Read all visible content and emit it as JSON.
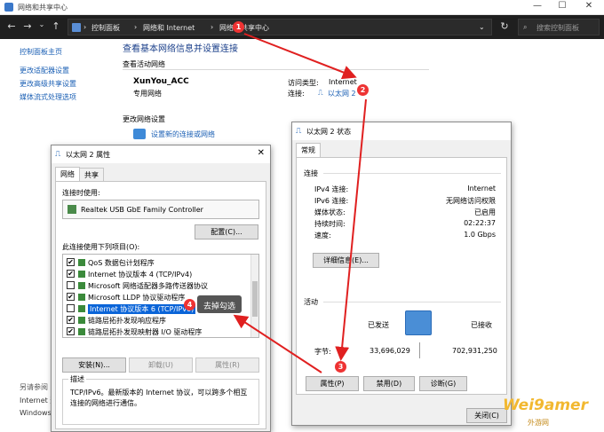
{
  "window": {
    "title": "网络和共享中心",
    "controls": [
      "—",
      "☐",
      "✕"
    ]
  },
  "address": {
    "crumbs": [
      "控制面板",
      "网络和 Internet",
      "网络和共享中心"
    ],
    "search_placeholder": "搜索控制面板"
  },
  "sidebar": {
    "items": [
      "控制面板主页",
      "更改适配器设置",
      "更改高级共享设置",
      "媒体流式处理选项"
    ],
    "see_also": "另请参阅",
    "bottom": [
      "Internet 选",
      "Windows"
    ]
  },
  "main": {
    "heading": "查看基本网络信息并设置连接",
    "active_networks": "查看活动网络",
    "network_name": "XunYou_ACC",
    "network_type": "专用网络",
    "access_type_label": "访问类型:",
    "access_type_value": "Internet",
    "connection_label": "连接:",
    "connection_value": "以太网 2",
    "change_settings": "更改网络设置",
    "new_connection": "设置新的连接或网络"
  },
  "props": {
    "title": "以太网 2 属性",
    "tabs": [
      "网络",
      "共享"
    ],
    "connect_using": "连接时使用:",
    "adapter": "Realtek USB GbE Family Controller",
    "configure": "配置(C)...",
    "items_label": "此连接使用下列项目(O):",
    "items": [
      {
        "label": "QoS 数据包计划程序",
        "checked": true
      },
      {
        "label": "Internet 协议版本 4 (TCP/IPv4)",
        "checked": true
      },
      {
        "label": "Microsoft 网络适配器多路传送器协议",
        "checked": false
      },
      {
        "label": "Microsoft LLDP 协议驱动程序",
        "checked": true
      },
      {
        "label": "Internet 协议版本 6 (TCP/IPv6)",
        "checked": false
      },
      {
        "label": "链路层拓扑发现响应程序",
        "checked": true
      },
      {
        "label": "链路层拓扑发现映射器 I/O 驱动程序",
        "checked": true
      }
    ],
    "install": "安装(N)...",
    "uninstall": "卸载(U)",
    "properties": "属性(R)",
    "desc_label": "描述",
    "description": "TCP/IPv6。最新版本的 Internet 协议，可以跨多个相互连接的网络进行通信。",
    "tooltip": "去掉勾选"
  },
  "status": {
    "title": "以太网 2 状态",
    "tab": "常规",
    "connection_label": "连接",
    "rows": [
      {
        "k": "IPv4 连接:",
        "v": "Internet"
      },
      {
        "k": "IPv6 连接:",
        "v": "无网络访问权限"
      },
      {
        "k": "媒体状态:",
        "v": "已启用"
      },
      {
        "k": "持续时间:",
        "v": "02:22:37"
      },
      {
        "k": "速度:",
        "v": "1.0 Gbps"
      }
    ],
    "details": "详细信息(E)...",
    "activity": "活动",
    "sent": "已发送",
    "received": "已接收",
    "bytes_label": "字节:",
    "bytes_sent": "33,696,029",
    "bytes_received": "702,931,250",
    "properties": "属性(P)",
    "disable": "禁用(D)",
    "diagnose": "诊断(G)",
    "close": "关闭(C)"
  },
  "badges": [
    "1",
    "2",
    "3",
    "4"
  ],
  "watermark": {
    "main": "Wei9amer",
    "sub": "外游网"
  },
  "colors": {
    "accent": "#1a5fb4",
    "badge": "#e33333",
    "arrow": "#e02020"
  }
}
